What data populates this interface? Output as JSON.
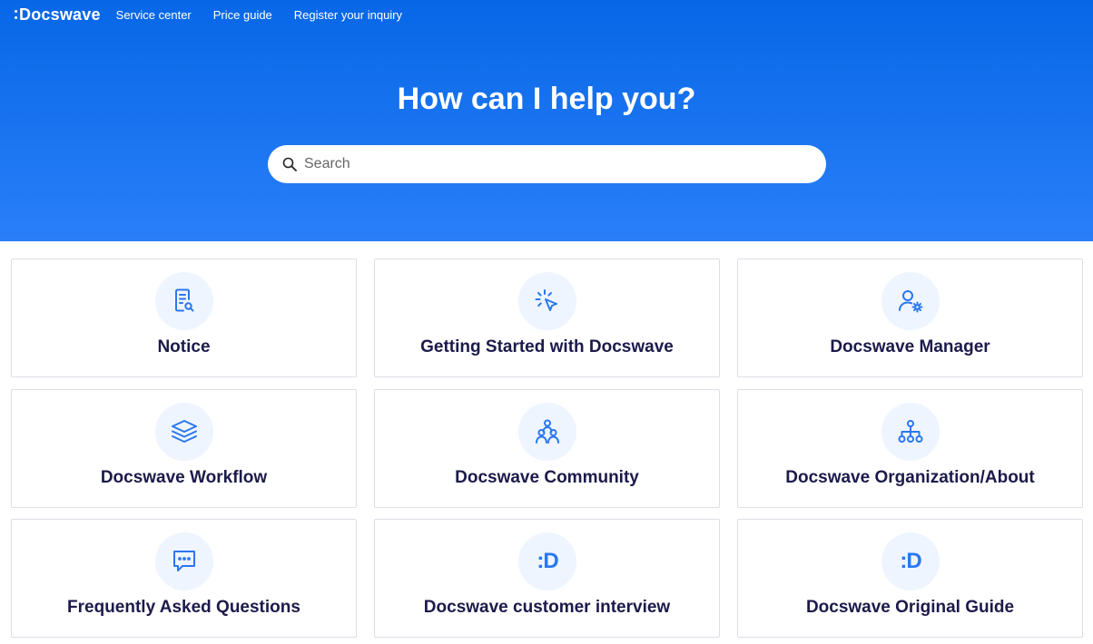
{
  "nav": {
    "logo": "Docswave",
    "links": [
      "Service center",
      "Price guide",
      "Register your inquiry"
    ]
  },
  "hero": {
    "title": "How can I help you?",
    "search_placeholder": "Search"
  },
  "colors": {
    "hero_top": "#0767e6",
    "hero_bottom": "#2a7ff9",
    "icon": "#2b77f0",
    "icon_bg": "#eef5ff",
    "card_text": "#1c1a4a"
  },
  "cards": [
    {
      "label": "Notice",
      "icon": "notice-document-search-icon"
    },
    {
      "label": "Getting Started with Docswave",
      "icon": "cursor-click-icon"
    },
    {
      "label": "Docswave Manager",
      "icon": "user-gear-icon"
    },
    {
      "label": "Docswave Workflow",
      "icon": "layers-stack-icon"
    },
    {
      "label": "Docswave Community",
      "icon": "people-group-icon"
    },
    {
      "label": "Docswave Organization/About",
      "icon": "org-chart-icon"
    },
    {
      "label": "Frequently Asked Questions",
      "icon": "chat-bubble-icon"
    },
    {
      "label": "Docswave customer interview",
      "icon": "docswave-logo-icon",
      "icon_text": ":D"
    },
    {
      "label": "Docswave Original Guide",
      "icon": "docswave-logo-icon",
      "icon_text": ":D"
    }
  ]
}
